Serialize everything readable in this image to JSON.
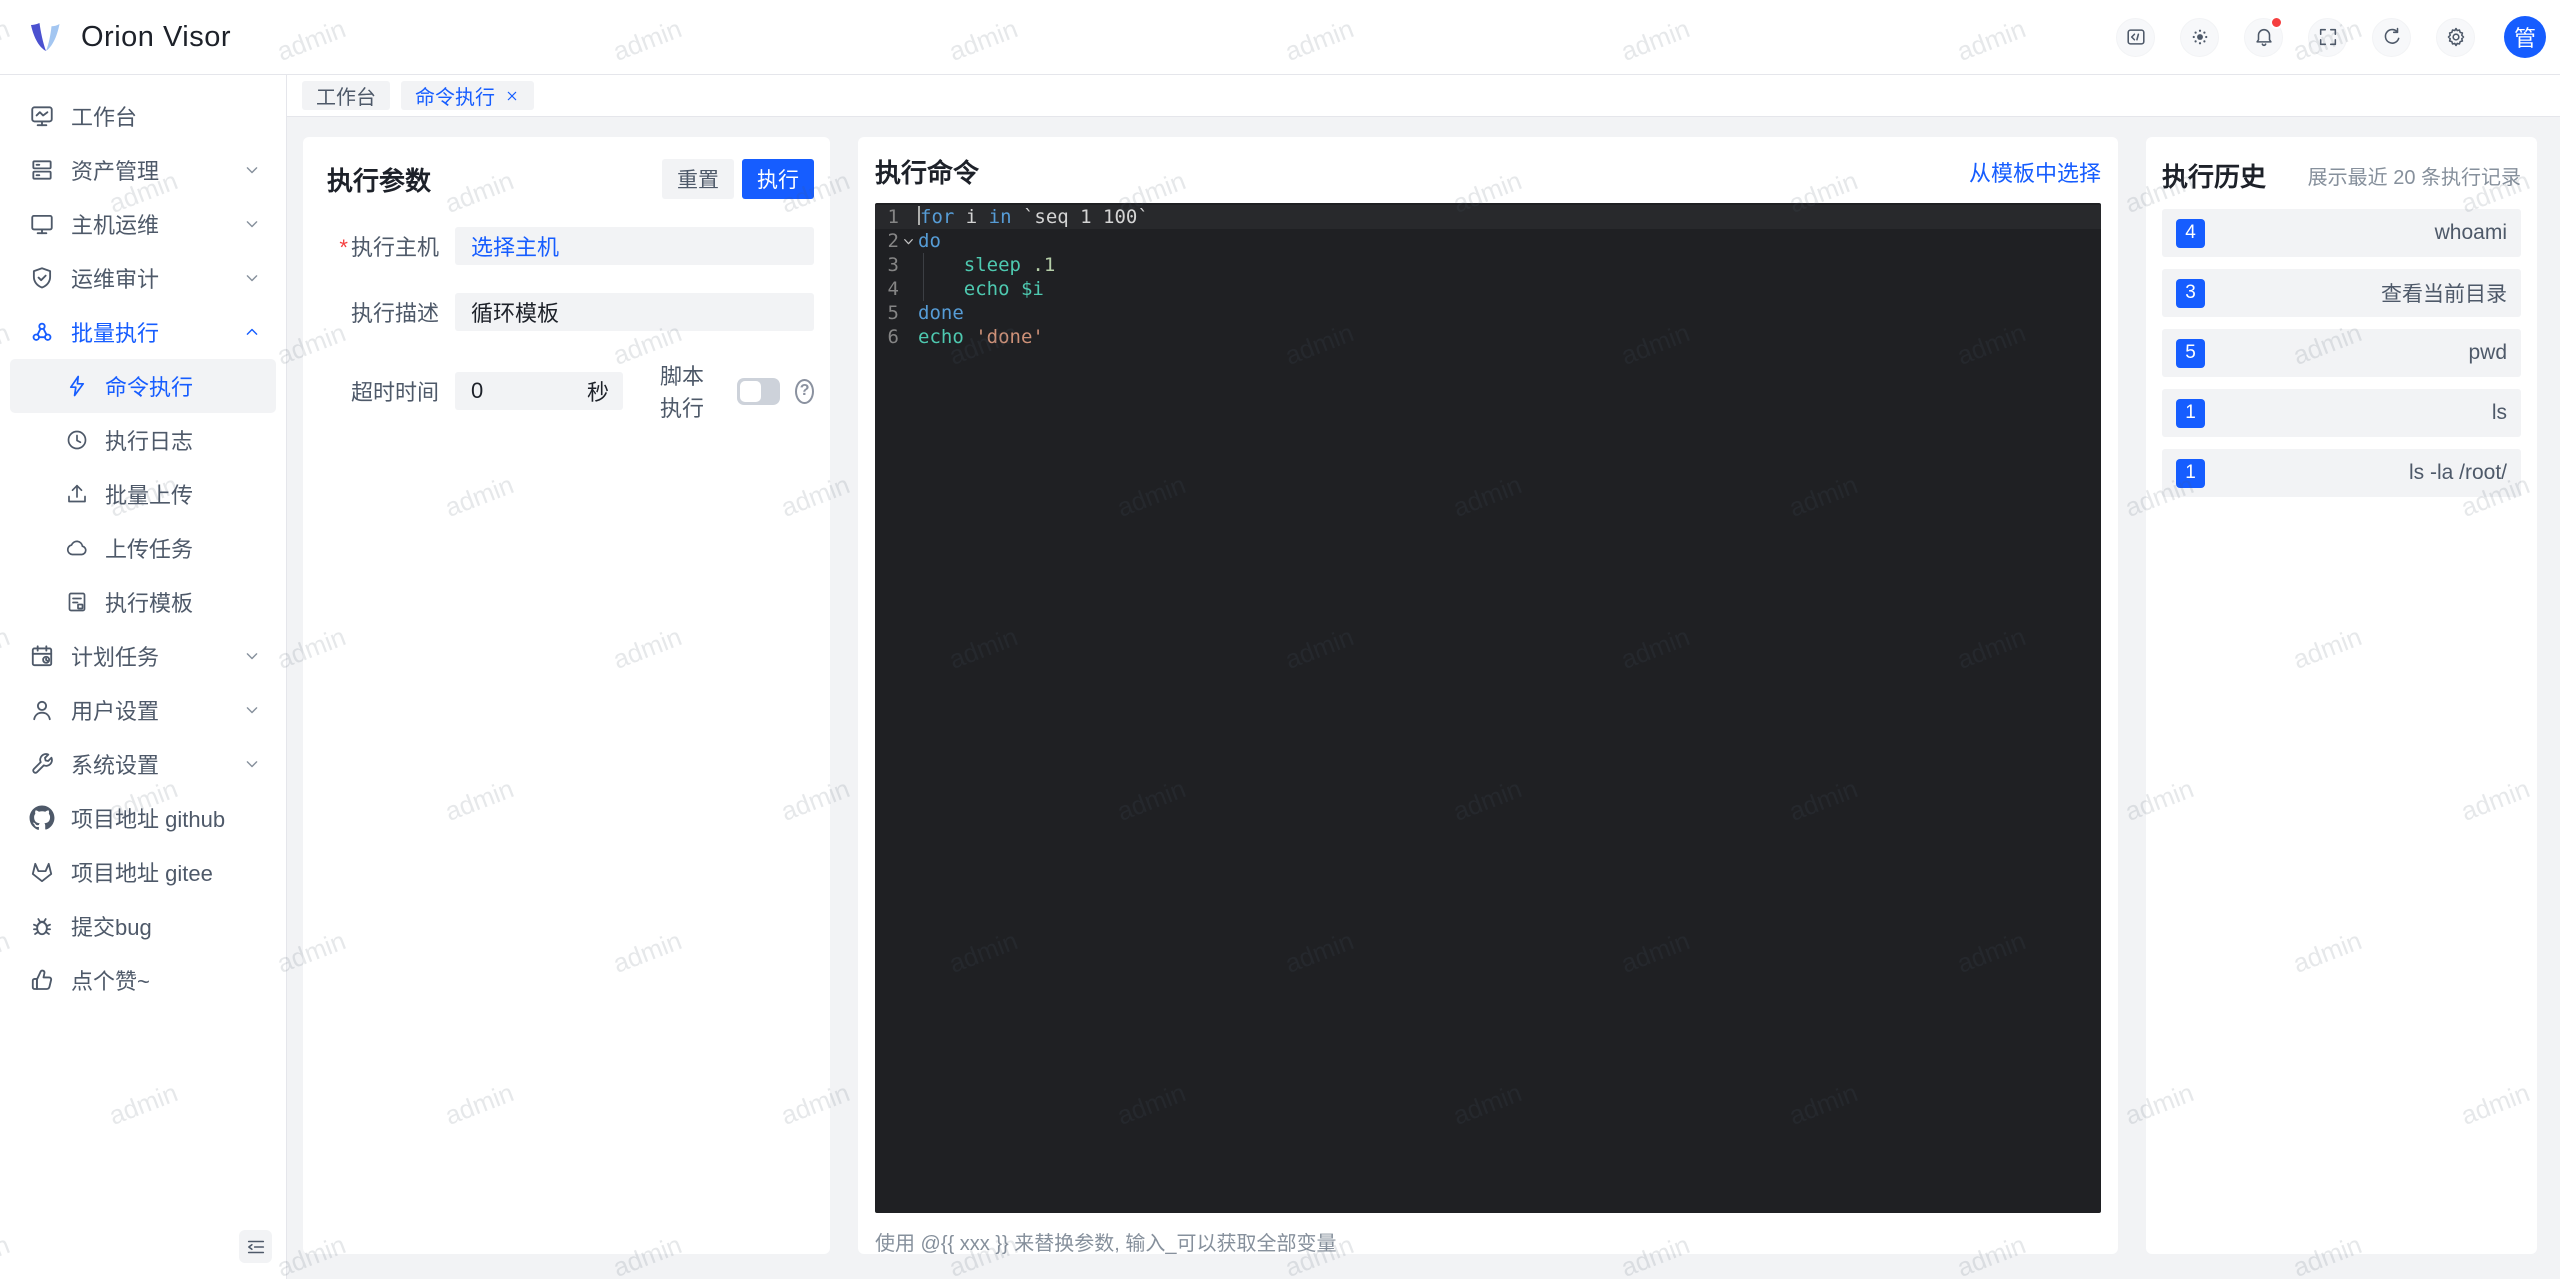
{
  "app": {
    "name": "Orion Visor"
  },
  "header": {
    "avatar_text": "管",
    "actions": [
      "code",
      "brightness",
      "bell",
      "fullscreen",
      "refresh",
      "gear"
    ],
    "notification_badge": true
  },
  "tabs": [
    {
      "label": "工作台",
      "active": false,
      "closable": false
    },
    {
      "label": "命令执行",
      "active": true,
      "closable": true
    }
  ],
  "sidebar": {
    "items": [
      {
        "id": "workbench",
        "label": "工作台",
        "icon": "dashboard"
      },
      {
        "id": "assets",
        "label": "资产管理",
        "icon": "assets",
        "expandable": true
      },
      {
        "id": "host-ops",
        "label": "主机运维",
        "icon": "host",
        "expandable": true
      },
      {
        "id": "audit",
        "label": "运维审计",
        "icon": "audit",
        "expandable": true
      },
      {
        "id": "batch-exec",
        "label": "批量执行",
        "icon": "batch",
        "expandable": true,
        "expanded": true,
        "active": true,
        "children": [
          {
            "id": "command-exec",
            "label": "命令执行",
            "icon": "flash",
            "selected": true
          },
          {
            "id": "exec-log",
            "label": "执行日志",
            "icon": "history"
          },
          {
            "id": "batch-upload",
            "label": "批量上传",
            "icon": "upload"
          },
          {
            "id": "upload-task",
            "label": "上传任务",
            "icon": "cloud"
          },
          {
            "id": "exec-template",
            "label": "执行模板",
            "icon": "template"
          }
        ]
      },
      {
        "id": "schedule",
        "label": "计划任务",
        "icon": "schedule",
        "expandable": true
      },
      {
        "id": "user-settings",
        "label": "用户设置",
        "icon": "user",
        "expandable": true
      },
      {
        "id": "system-settings",
        "label": "系统设置",
        "icon": "wrench",
        "expandable": true
      },
      {
        "id": "github",
        "label": "项目地址 github",
        "icon": "github"
      },
      {
        "id": "gitee",
        "label": "项目地址 gitee",
        "icon": "gitee"
      },
      {
        "id": "report-bug",
        "label": "提交bug",
        "icon": "bug"
      },
      {
        "id": "like",
        "label": "点个赞~",
        "icon": "thumb"
      }
    ]
  },
  "exec_params": {
    "title": "执行参数",
    "reset_label": "重置",
    "run_label": "执行",
    "host_label": "执行主机",
    "host_placeholder": "选择主机",
    "desc_label": "执行描述",
    "desc_value": "循环模板",
    "timeout_label": "超时时间",
    "timeout_value": "0",
    "timeout_unit": "秒",
    "script_label": "脚本执行",
    "script_enabled": false
  },
  "exec_command": {
    "title": "执行命令",
    "template_link": "从模板中选择",
    "hint": "使用 @{{ xxx }} 来替换参数, 输入_可以获取全部变量",
    "editor": {
      "language": "shell",
      "lines": [
        {
          "num": 1,
          "current": true,
          "segments": [
            [
              "kw",
              "for"
            ],
            [
              "plain",
              " i "
            ],
            [
              "kw",
              "in"
            ],
            [
              "plain",
              " `seq 1 100`"
            ]
          ]
        },
        {
          "num": 2,
          "fold": true,
          "segments": [
            [
              "kw",
              "do"
            ]
          ]
        },
        {
          "num": 3,
          "segments": [
            [
              "plain",
              "    "
            ],
            [
              "cmd",
              "sleep"
            ],
            [
              "plain",
              " "
            ],
            [
              "num",
              ".1"
            ]
          ]
        },
        {
          "num": 4,
          "segments": [
            [
              "plain",
              "    "
            ],
            [
              "cmd",
              "echo"
            ],
            [
              "plain",
              " "
            ],
            [
              "var",
              "$i"
            ]
          ]
        },
        {
          "num": 5,
          "segments": [
            [
              "kw",
              "done"
            ]
          ]
        },
        {
          "num": 6,
          "segments": [
            [
              "cmd",
              "echo"
            ],
            [
              "plain",
              " "
            ],
            [
              "str",
              "'done'"
            ]
          ]
        }
      ]
    }
  },
  "exec_history": {
    "title": "执行历史",
    "subtitle": "展示最近 20 条执行记录",
    "items": [
      {
        "count": "4",
        "command": "whoami"
      },
      {
        "count": "3",
        "command": "查看当前目录"
      },
      {
        "count": "5",
        "command": "pwd"
      },
      {
        "count": "1",
        "command": "ls"
      },
      {
        "count": "1",
        "command": "ls -la /root/"
      }
    ]
  },
  "watermark": {
    "text": "admin"
  },
  "colors": {
    "accent": "#165dff",
    "danger": "#f53f3f",
    "editor_bg": "#1f2023",
    "syntax": {
      "keyword": "#569cd6",
      "command": "#4ec9b0",
      "number": "#b5cea8",
      "string": "#ce9178",
      "plain": "#d4d4d4"
    }
  },
  "icons": {
    "header": [
      "code-icon",
      "brightness-icon",
      "bell-icon",
      "fullscreen-icon",
      "refresh-icon",
      "gear-icon"
    ],
    "misc": [
      "close-icon",
      "chevron-down-icon",
      "chevron-up-icon",
      "menu-fold-icon",
      "question-icon"
    ]
  }
}
